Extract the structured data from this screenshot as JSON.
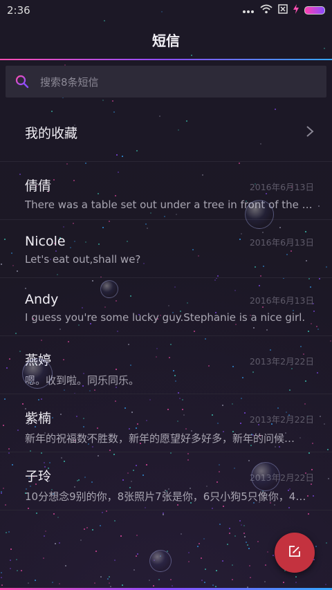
{
  "status_bar": {
    "time": "2:36",
    "icons": [
      "more-dots-icon",
      "wifi-icon",
      "no-sim-icon",
      "charging-icon",
      "battery-icon"
    ]
  },
  "header": {
    "title": "短信"
  },
  "search": {
    "placeholder": "搜索8条短信"
  },
  "favorites": {
    "label": "我的收藏"
  },
  "messages": [
    {
      "name": "倩倩",
      "date": "2016年6月13日",
      "preview": "There was a table set out under a tree in front of the ho…"
    },
    {
      "name": "Nicole",
      "date": "2016年6月13日",
      "preview": "Let's eat out,shall we?"
    },
    {
      "name": "Andy",
      "date": "2016年6月13日",
      "preview": "I guess you're some lucky guy.Stephanie is a nice girl."
    },
    {
      "name": "燕婷",
      "date": "2013年2月22日",
      "preview": "嗯。收到啦。同乐同乐。"
    },
    {
      "name": "紫楠",
      "date": "2013年2月22日",
      "preview": "新年的祝福数不胜数，新年的愿望好多好多，新年的问候…"
    },
    {
      "name": "子玲",
      "date": "2013年2月22日",
      "preview": "10分想念9别的你，8张照片7张是你，6只小狗5只像你，4…"
    }
  ],
  "colors": {
    "accent_red": "#c4323f",
    "background": "#1c1826",
    "accent_gradient": [
      "#ff4fb2",
      "#8c4dff",
      "#35a8ff"
    ]
  },
  "fab": {
    "icon": "compose-icon"
  }
}
